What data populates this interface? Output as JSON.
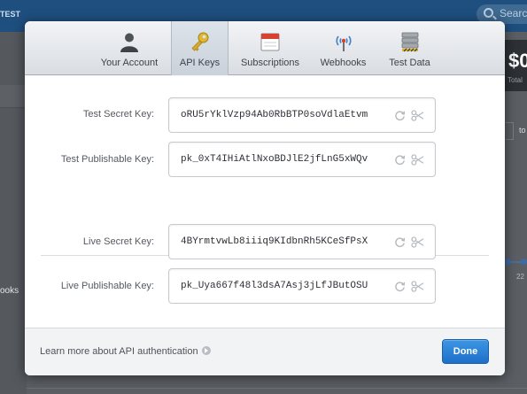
{
  "background": {
    "env_label": "TEST",
    "search_placeholder": "Search",
    "left_item_fragment": "ooks",
    "stat_fragment": "$0",
    "stat_caption_fragment": "Total",
    "range_fragment": "to",
    "axis_tick_fragment": "22"
  },
  "toolbar": {
    "tabs": [
      {
        "label": "Your Account",
        "icon": "person-icon"
      },
      {
        "label": "API Keys",
        "icon": "key-icon"
      },
      {
        "label": "Subscriptions",
        "icon": "calendar-icon"
      },
      {
        "label": "Webhooks",
        "icon": "antenna-icon"
      },
      {
        "label": "Test Data",
        "icon": "database-icon"
      }
    ],
    "active_tab": "API Keys"
  },
  "keys": {
    "test": [
      {
        "label": "Test Secret Key:",
        "value": "oRU5rYklVzp94Ab0RbBTP0soVdlaEtvm"
      },
      {
        "label": "Test Publishable Key:",
        "value": "pk_0xT4IHiAtlNxoBDJlE2jfLnG5xWQv"
      }
    ],
    "live": [
      {
        "label": "Live Secret Key:",
        "value": "4BYrmtvwLb8iiiq9KIdbnRh5KCeSfPsX"
      },
      {
        "label": "Live Publishable Key:",
        "value": "pk_Uya667f48l3dsA7Asj3jLfJButOSU"
      }
    ]
  },
  "footer": {
    "learn_more": "Learn more about API authentication",
    "done_label": "Done"
  },
  "colors": {
    "accent": "#2a80d6",
    "topbar": "#1f4f7f"
  }
}
